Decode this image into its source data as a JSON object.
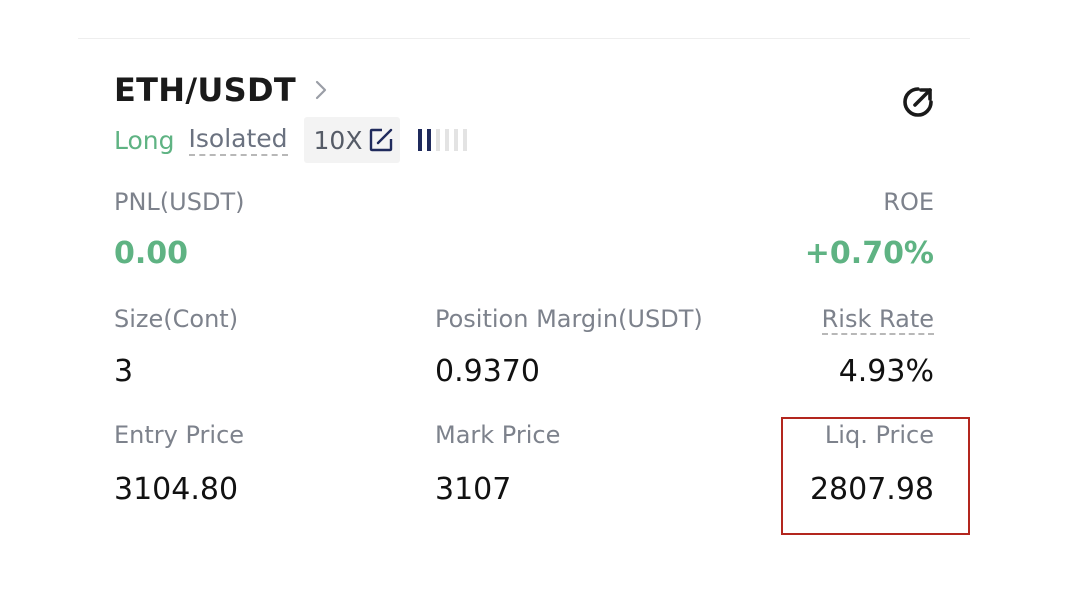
{
  "position": {
    "pair": "ETH/USDT",
    "side": "Long",
    "margin_mode": "Isolated",
    "leverage": "10X",
    "risk_level_bars": {
      "filled": 2,
      "total": 6
    }
  },
  "pnl": {
    "label": "PNL(USDT)",
    "value": "0.00"
  },
  "roe": {
    "label": "ROE",
    "value": "+0.70%"
  },
  "size": {
    "label": "Size(Cont)",
    "value": "3"
  },
  "position_margin": {
    "label": "Position Margin(USDT)",
    "value": "0.9370"
  },
  "risk_rate": {
    "label": "Risk Rate",
    "value": "4.93%"
  },
  "entry_price": {
    "label": "Entry Price",
    "value": "3104.80"
  },
  "mark_price": {
    "label": "Mark Price",
    "value": "3107"
  },
  "liq_price": {
    "label": "Liq. Price",
    "value": "2807.98"
  },
  "colors": {
    "profit_green": "#5fb383",
    "highlight_red": "#b3261e",
    "risk_bar_active": "#1f2a5c"
  },
  "icons": {
    "pair_chevron": "chevron-right-icon",
    "leverage_edit": "edit-icon",
    "share": "share-icon"
  }
}
